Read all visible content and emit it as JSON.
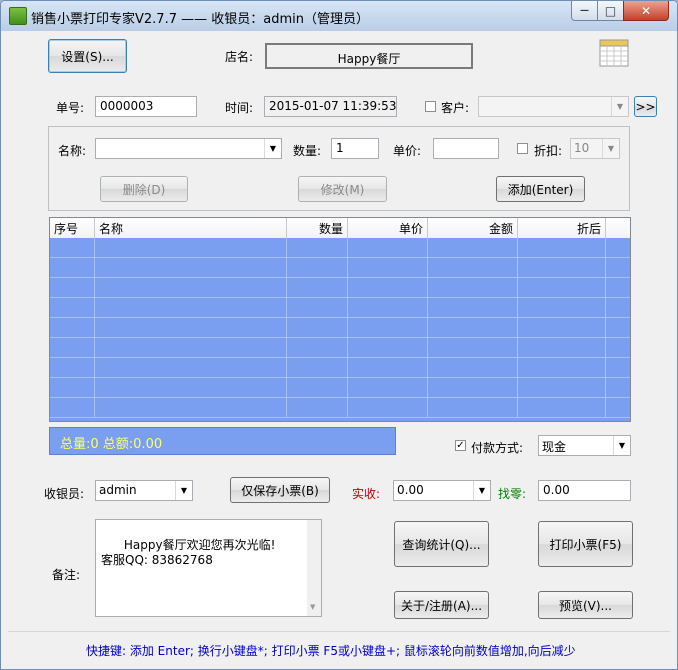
{
  "window": {
    "title": "销售小票打印专家V2.7.7 —— 收银员：admin（管理员）",
    "controls": {
      "minimize": "—",
      "maximize": "□",
      "close": "✕"
    }
  },
  "top": {
    "settings_button": "设置(S)...",
    "shop_label": "店名:",
    "shop_name": "Happy餐厅",
    "ticket_no_label": "单号:",
    "ticket_no": "0000003",
    "time_label": "时间:",
    "time_value": "2015-01-07 11:39:53",
    "customer_label": "客户:",
    "customer_value": "",
    "more_button": ">>"
  },
  "item": {
    "name_label": "名称:",
    "name_value": "",
    "qty_label": "数量:",
    "qty_value": "1",
    "price_label": "单价:",
    "price_value": "",
    "discount_label": "折扣:",
    "discount_value": "10",
    "delete_button": "删除(D)",
    "modify_button": "修改(M)",
    "add_button": "添加(Enter)"
  },
  "grid": {
    "columns": [
      "序号",
      "名称",
      "数量",
      "单价",
      "金额",
      "折后"
    ],
    "rows": []
  },
  "totals": {
    "text": "总量:0  总额:0.00"
  },
  "payment": {
    "label": "付款方式:",
    "checked": true,
    "method": "现金"
  },
  "cashier": {
    "label": "收银员:",
    "value": "admin",
    "save_only_button": "仅保存小票(B)",
    "received_label": "实收:",
    "received_value": "0.00",
    "change_label": "找零:",
    "change_value": "0.00",
    "received_color": "#c00000",
    "change_color": "#008000"
  },
  "notes": {
    "label": "备注:",
    "text": "Happy餐厅欢迎您再次光临!\n客服QQ: 83862768"
  },
  "actions": {
    "query_button": "查询统计(Q)...",
    "print_button": "打印小票(F5)",
    "about_button": "关于/注册(A)...",
    "preview_button": "预览(V)..."
  },
  "status": {
    "shortcuts": "快捷键: 添加 Enter; 换行小键盘*; 打印小票 F5或小键盘+; 鼠标滚轮向前数值增加,向后减少"
  },
  "colors": {
    "grid_bg": "#7b9ff0",
    "totals_text": "#ffff66",
    "shortcut_text": "#0000c8"
  },
  "icons": {
    "app": "app-icon",
    "calendar": "calendar-icon"
  }
}
